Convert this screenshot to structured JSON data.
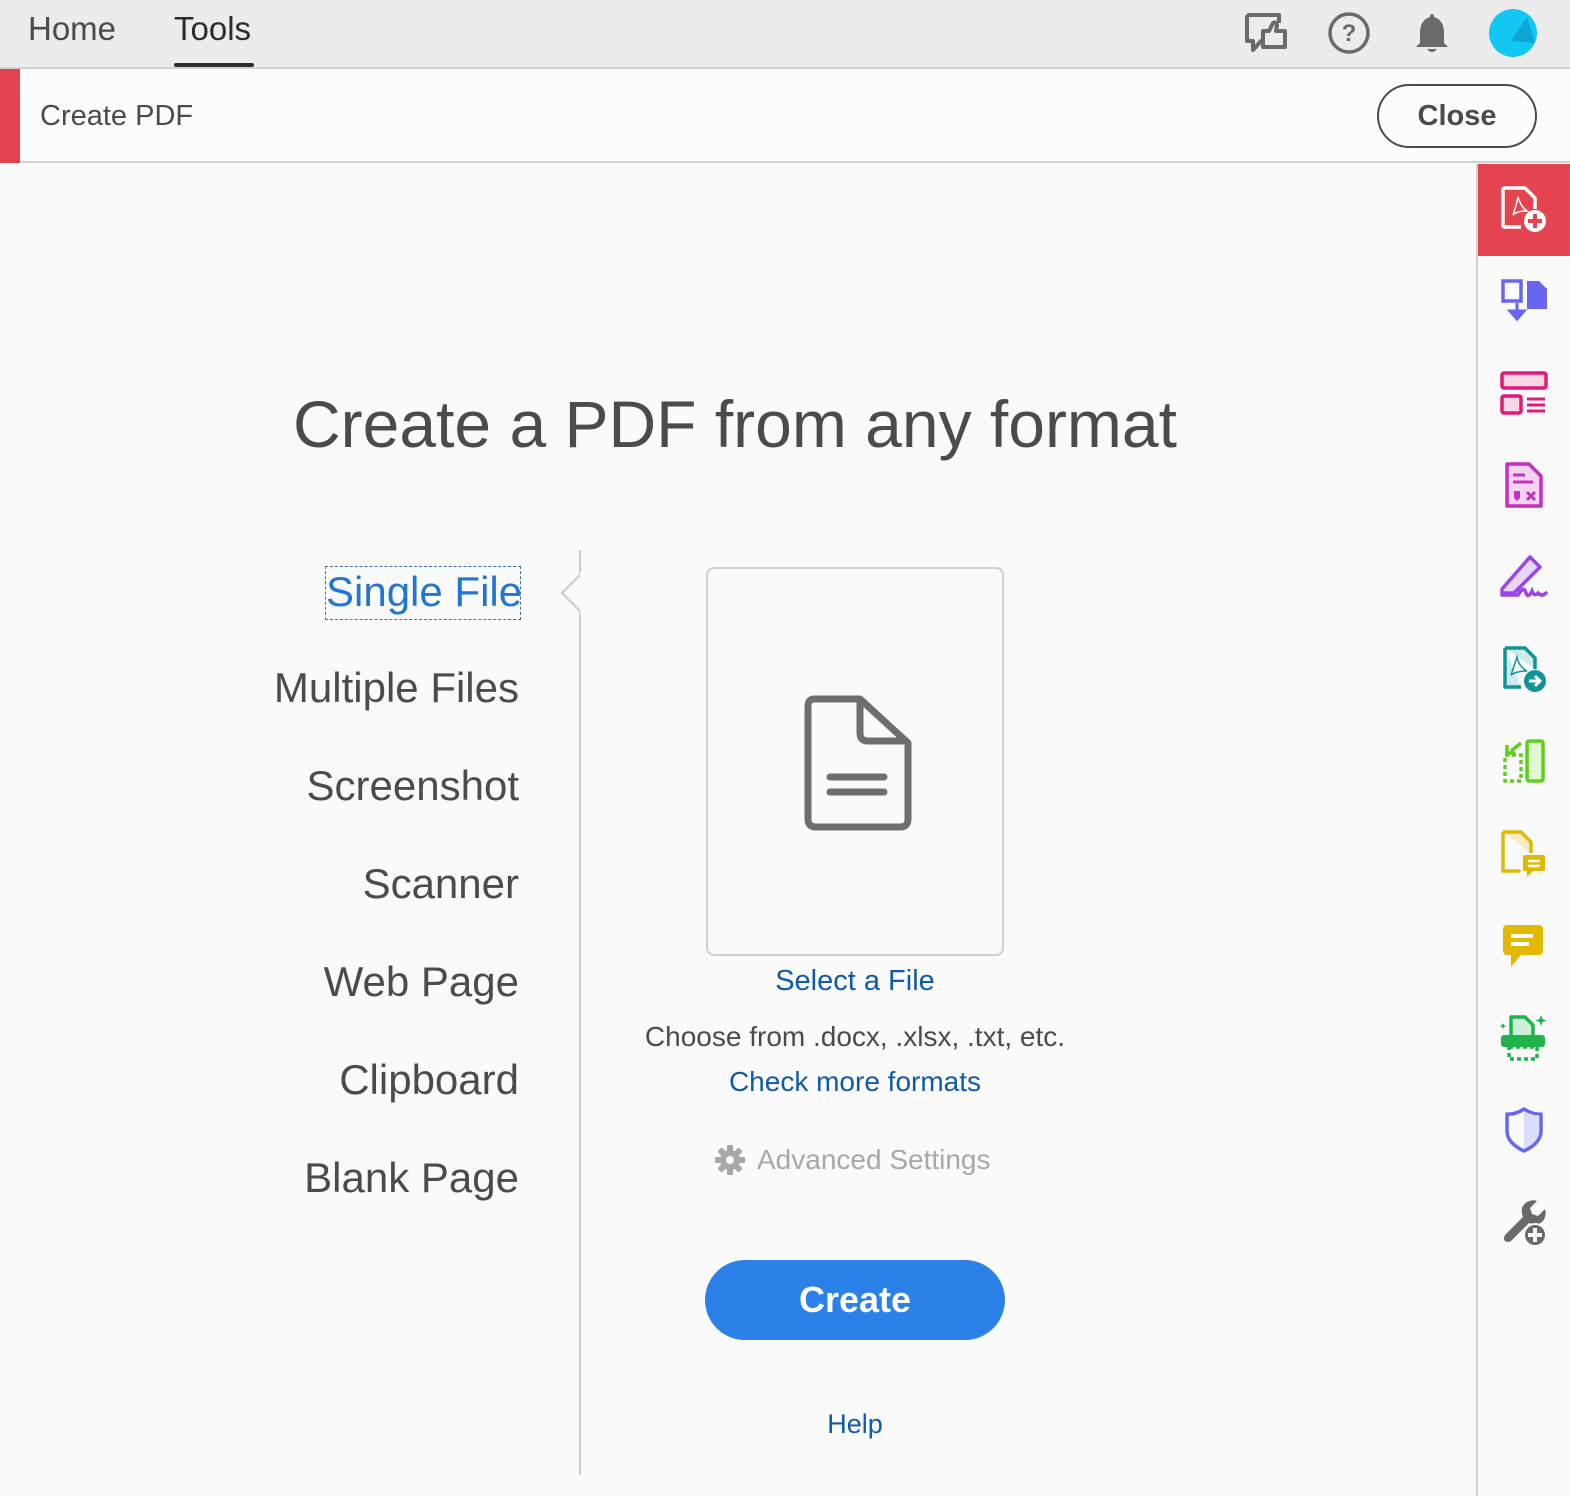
{
  "topbar": {
    "tabs": [
      {
        "label": "Home",
        "active": false
      },
      {
        "label": "Tools",
        "active": true
      }
    ],
    "icons": [
      "feedback-icon",
      "help-icon",
      "notifications-bell-icon",
      "account-avatar"
    ],
    "avatar_color": "#12c8f3"
  },
  "toolbar": {
    "title": "Create PDF",
    "close_label": "Close",
    "accent_color": "#e44350"
  },
  "main": {
    "headline": "Create a PDF from any format",
    "options": [
      {
        "label": "Single File",
        "selected": true
      },
      {
        "label": "Multiple Files",
        "selected": false
      },
      {
        "label": "Screenshot",
        "selected": false
      },
      {
        "label": "Scanner",
        "selected": false
      },
      {
        "label": "Web Page",
        "selected": false
      },
      {
        "label": "Clipboard",
        "selected": false
      },
      {
        "label": "Blank Page",
        "selected": false
      }
    ],
    "select_file_label": "Select a File",
    "formats_text": "Choose from .docx, .xlsx, .txt, etc.",
    "check_formats_label": "Check more formats",
    "advanced_settings_label": "Advanced Settings",
    "create_label": "Create",
    "help_label": "Help",
    "primary_color": "#2b81e8",
    "link_color": "#0f5ba8"
  },
  "right_rail": {
    "tools": [
      {
        "name": "create-pdf",
        "active": true
      },
      {
        "name": "combine-files",
        "active": false
      },
      {
        "name": "organize-pages",
        "active": false
      },
      {
        "name": "prepare-form",
        "active": false
      },
      {
        "name": "fill-and-sign",
        "active": false
      },
      {
        "name": "export-pdf",
        "active": false
      },
      {
        "name": "compress-pdf",
        "active": false
      },
      {
        "name": "send-for-comments",
        "active": false
      },
      {
        "name": "comment",
        "active": false
      },
      {
        "name": "scan-and-ocr",
        "active": false
      },
      {
        "name": "protect",
        "active": false
      },
      {
        "name": "more-tools",
        "active": false
      }
    ]
  }
}
